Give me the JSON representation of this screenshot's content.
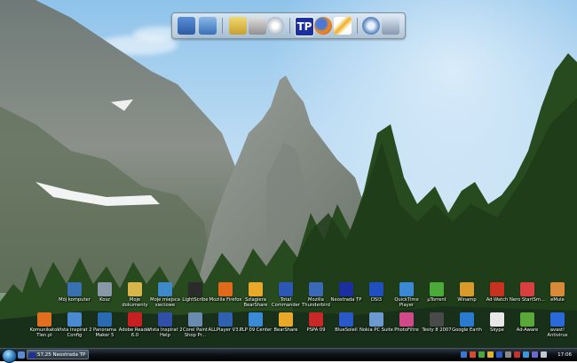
{
  "toolbar": {
    "icons": [
      "computer-icon",
      "network-icon",
      "documents-icon",
      "camera-icon",
      "disc-icon",
      "tp-icon",
      "firefox-icon",
      "lightning-icon",
      "settings-icon",
      "recycle-bin-icon"
    ],
    "tp_label": "TP"
  },
  "desktop_row1": [
    {
      "name": "Mój komputer",
      "icon": "computer-icon",
      "color": "#3a6fb0"
    },
    {
      "name": "Kosz",
      "icon": "recycle-bin-icon",
      "color": "#8a97a6"
    },
    {
      "name": "Moje dokumenty",
      "icon": "folder-icon",
      "color": "#d8b54a"
    },
    {
      "name": "Moje miejsca sieciowe",
      "icon": "network-icon",
      "color": "#3e8ac8"
    },
    {
      "name": "LightScribe",
      "icon": "lightscribe-icon",
      "color": "#2b2b2b"
    },
    {
      "name": "Mozilla Firefox",
      "icon": "firefox-icon",
      "color": "#e06a1b"
    },
    {
      "name": "Szlagiera BearShare",
      "icon": "bearshare-icon",
      "color": "#e8a92b"
    },
    {
      "name": "Total Commander",
      "icon": "floppy-icon",
      "color": "#2c57b5"
    },
    {
      "name": "Mozilla Thunderbird",
      "icon": "thunderbird-icon",
      "color": "#3a6ab7"
    },
    {
      "name": "Neostrada TP",
      "icon": "tp-icon",
      "color": "#1c2f9e"
    },
    {
      "name": "DSI3",
      "icon": "dsi-icon",
      "color": "#2050c0"
    },
    {
      "name": "QuickTime Player",
      "icon": "quicktime-icon",
      "color": "#3b88d4"
    },
    {
      "name": "µTorrent",
      "icon": "utorrent-icon",
      "color": "#4caa3a"
    },
    {
      "name": "Winamp",
      "icon": "winamp-icon",
      "color": "#d89a2a"
    },
    {
      "name": "Ad-Watch",
      "icon": "adwatch-icon",
      "color": "#c8321e"
    },
    {
      "name": "Nero StartSm...",
      "icon": "nero-icon",
      "color": "#d84040"
    },
    {
      "name": "eMule",
      "icon": "emule-icon",
      "color": "#d88a38"
    }
  ],
  "desktop_row2": [
    {
      "name": "Komunikator Tlen.pl",
      "icon": "tlen-icon",
      "color": "#e07020"
    },
    {
      "name": "Vista Inspirat 2 Config",
      "icon": "vista-inspirat-icon",
      "color": "#4a8ad0"
    },
    {
      "name": "Panorama Maker 5",
      "icon": "panorama-icon",
      "color": "#2a6ab0"
    },
    {
      "name": "Adobe Reader 6.0",
      "icon": "adobe-icon",
      "color": "#c82020"
    },
    {
      "name": "Vista Inspirat 2 Help",
      "icon": "help-icon",
      "color": "#3050a8"
    },
    {
      "name": "Corel Paint Shop Pr...",
      "icon": "corel-icon",
      "color": "#6a8ab0"
    },
    {
      "name": "ALLPlayer V3.1",
      "icon": "allplayer-icon",
      "color": "#3060b0"
    },
    {
      "name": "PLP 09 Center",
      "icon": "plp-icon",
      "color": "#3a8ad8"
    },
    {
      "name": "BearShare",
      "icon": "bearshare-icon",
      "color": "#e8a92b"
    },
    {
      "name": "PSPA 09",
      "icon": "pspa-icon",
      "color": "#c82828"
    },
    {
      "name": "BlueSoleil",
      "icon": "bluetooth-icon",
      "color": "#2a58c8"
    },
    {
      "name": "Nokia PC Suite",
      "icon": "nokia-icon",
      "color": "#6a9ad0"
    },
    {
      "name": "PhotoFiltre",
      "icon": "photofiltre-icon",
      "color": "#d04a8a"
    },
    {
      "name": "Testy 8 2007",
      "icon": "testy-icon",
      "color": "#4a4a4a"
    },
    {
      "name": "Google Earth",
      "icon": "globe-icon",
      "color": "#2a7ad0"
    },
    {
      "name": "Skype",
      "icon": "document-icon",
      "color": "#e8e8e8"
    },
    {
      "name": "Ad-Aware",
      "icon": "adaware-icon",
      "color": "#5aa83a"
    },
    {
      "name": "avast! Antivirus",
      "icon": "avast-icon",
      "color": "#2a6ad8"
    }
  ],
  "taskbar": {
    "task_label": "57,25 Neostrada TP",
    "clock": "17:06"
  }
}
